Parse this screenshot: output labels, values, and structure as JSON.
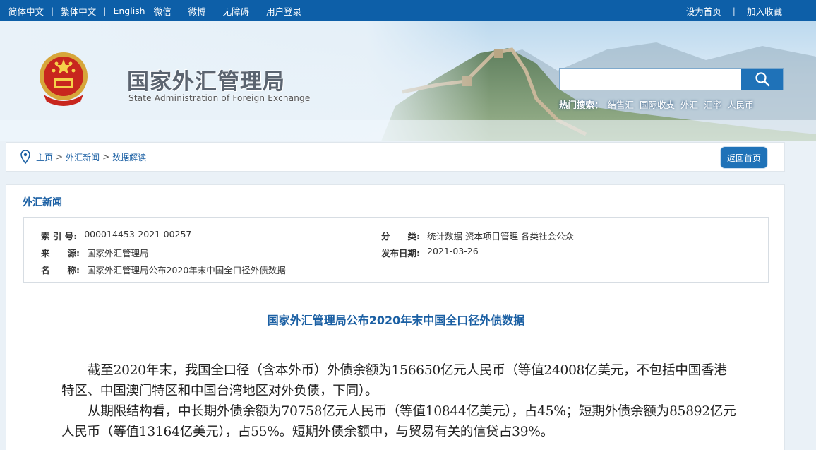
{
  "topbar": {
    "lang_simplified": "简体中文",
    "lang_traditional": "繁体中文",
    "lang_english": "English",
    "wechat": "微信",
    "weibo": "微博",
    "accessibility": "无障碍",
    "login": "用户登录",
    "set_home": "设为首页",
    "add_favorite": "加入收藏",
    "separator": "|"
  },
  "header": {
    "title": "国家外汇管理局",
    "subtitle": "State Administration of Foreign Exchange",
    "search": {
      "value": "",
      "placeholder": ""
    },
    "hot_label": "热门搜索：",
    "hot_terms": [
      "结售汇",
      "国际收支",
      "外汇",
      "汇率",
      "人民币"
    ]
  },
  "breadcrumb": {
    "items": [
      "主页",
      "外汇新闻",
      "数据解读"
    ],
    "sep": ">",
    "back_button": "返回首页"
  },
  "content": {
    "section": "外汇新闻",
    "meta": {
      "index_key": "索 引 号:",
      "index_val": "000014453-2021-00257",
      "category_key": "分　　类:",
      "category_val": "统计数据 资本项目管理 各类社会公众",
      "source_key": "来　　源:",
      "source_val": "国家外汇管理局",
      "date_key": "发布日期:",
      "date_val": "2021-03-26",
      "name_key": "名　　称:",
      "name_val": "国家外汇管理局公布2020年末中国全口径外债数据"
    },
    "article_title": "国家外汇管理局公布2020年末中国全口径外债数据",
    "paragraphs": [
      "截至2020年末，我国全口径（含本外币）外债余额为156650亿元人民币（等值24008亿美元，不包括中国香港特区、中国澳门特区和中国台湾地区对外负债，下同）。",
      "从期限结构看，中长期外债余额为70758亿元人民币（等值10844亿美元），占45%；短期外债余额为85892亿元人民币（等值13164亿美元），占55%。短期外债余额中，与贸易有关的信贷占39%。"
    ]
  },
  "colors": {
    "brand_blue": "#0d5fa8",
    "link_blue": "#1a5fa3",
    "button_blue": "#1f72b8"
  }
}
